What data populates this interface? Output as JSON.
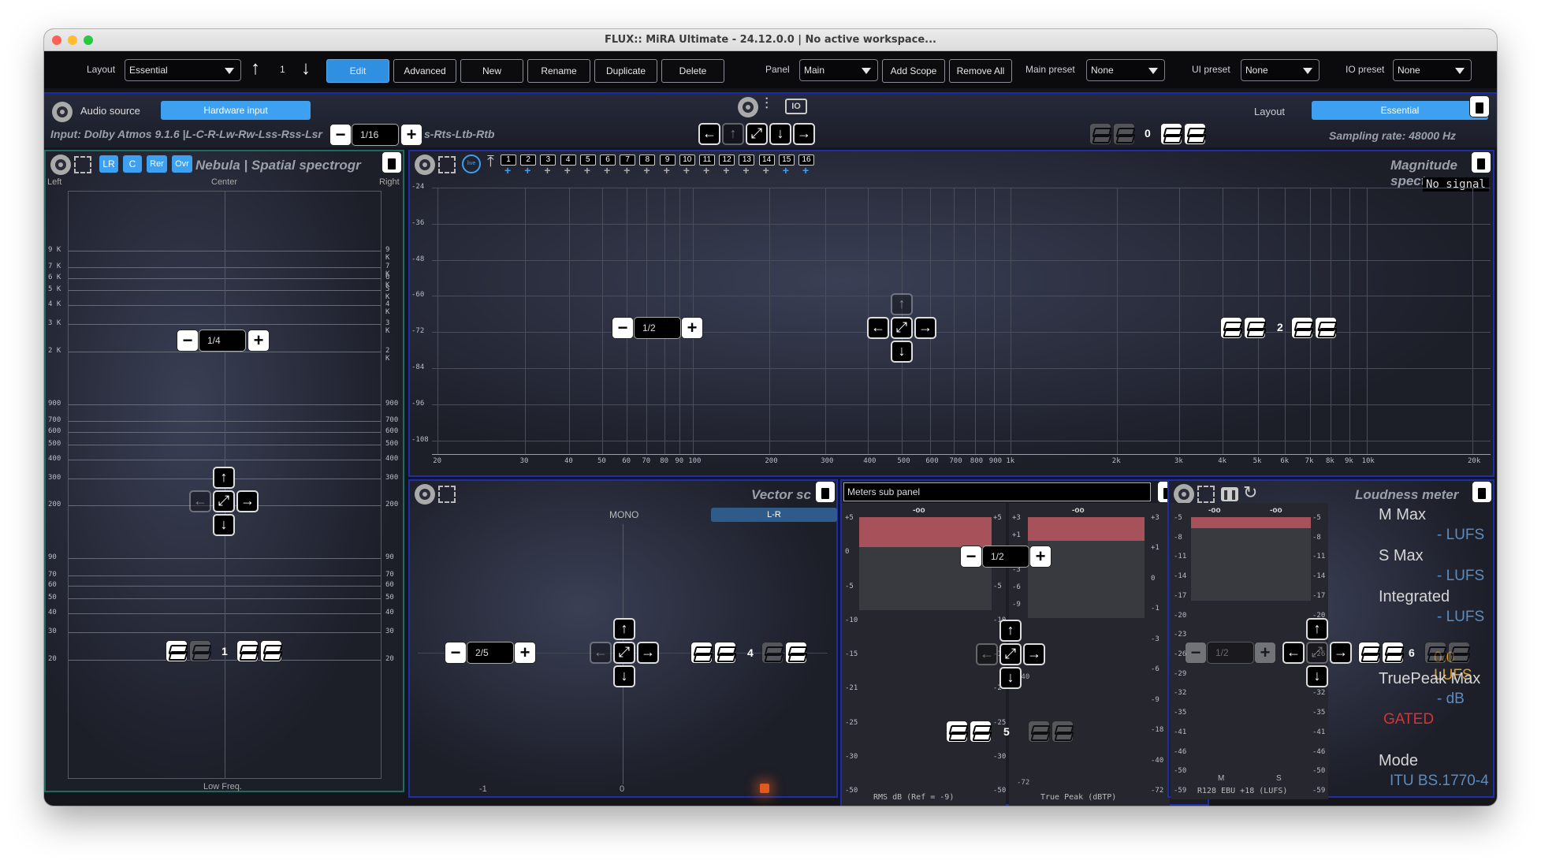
{
  "window": {
    "title": "FLUX:: MiRA Ultimate - 24.12.0.0 | No active workspace..."
  },
  "toolbar": {
    "layout_label": "Layout",
    "layout_value": "Essential",
    "layout_index": "1",
    "edit": "Edit",
    "advanced": "Advanced",
    "new": "New",
    "rename": "Rename",
    "duplicate": "Duplicate",
    "delete": "Delete",
    "panel_label": "Panel",
    "panel_value": "Main",
    "add_scope": "Add Scope",
    "remove_all": "Remove All",
    "main_preset_label": "Main preset",
    "main_preset_value": "None",
    "ui_preset_label": "UI preset",
    "ui_preset_value": "None",
    "io_preset_label": "IO preset",
    "io_preset_value": "None"
  },
  "source_bar": {
    "audio_source_label": "Audio source",
    "hardware_input": "Hardware input",
    "input_text": "Input: Dolby Atmos 9.1.6 |L-C-R-Lw-Rw-Lss-Rss-Lsr",
    "input_tail": "s-Rts-Ltb-Rtb",
    "division": "1/16",
    "layout_label": "Layout",
    "layout_value": "Essential",
    "layer_count": "0",
    "sampling_rate": "Sampling rate: 48000 Hz"
  },
  "nebula": {
    "buttons": [
      "LR",
      "C",
      "Rer",
      "Ovr"
    ],
    "title": "Nebula | Spatial spectrogr",
    "left": "Left",
    "center": "Center",
    "right": "Right",
    "bottom": "Low Freq.",
    "division": "1/4",
    "layer": "1",
    "ticks": [
      "9 K",
      "7 K",
      "6 K",
      "5 K",
      "4 K",
      "3 K",
      "2 K",
      "900",
      "700",
      "600",
      "500",
      "400",
      "300",
      "200",
      "90",
      "70",
      "60",
      "50",
      "40",
      "30",
      "20"
    ]
  },
  "magnitude": {
    "title": "Magnitude spectr",
    "no_signal": "No signal",
    "channels": [
      "1",
      "2",
      "3",
      "4",
      "5",
      "6",
      "7",
      "8",
      "9",
      "10",
      "11",
      "12",
      "13",
      "14",
      "15",
      "16"
    ],
    "y_ticks": [
      "-24",
      "-36",
      "-48",
      "-60",
      "-72",
      "-84",
      "-96",
      "-108"
    ],
    "x_ticks": [
      "20",
      "30",
      "40",
      "50",
      "60",
      "70",
      "80",
      "90",
      "100",
      "200",
      "300",
      "400",
      "500",
      "600",
      "700",
      "800",
      "900",
      "1k",
      "2k",
      "3k",
      "4k",
      "5k",
      "6k",
      "7k",
      "8k",
      "9k",
      "10k",
      "20k"
    ],
    "division": "1/2",
    "layer": "2"
  },
  "vector": {
    "title": "Vector sc",
    "mono": "MONO",
    "lr": "L-R",
    "division": "2/5",
    "layer": "4",
    "x_left": "-1",
    "x_mid": "0"
  },
  "meters": {
    "title": "Meters sub panel",
    "division": "1/2",
    "layer": "5",
    "rms_ticks": [
      "+5",
      "0",
      "-5",
      "-10",
      "-15",
      "-21",
      "-25",
      "-30",
      "-50"
    ],
    "rms_right_ticks": [
      "+5",
      "0",
      "-5",
      "-10",
      "-15",
      "-2",
      "-25",
      "-30",
      "-50"
    ],
    "tp_left_ticks": [
      "+3",
      "+1",
      "0",
      "-3",
      "-6",
      "-9"
    ],
    "tp_ticks": [
      "+3",
      "+1",
      "0",
      "-1",
      "-3",
      "-6",
      "-9",
      "-18",
      "-40",
      "-72"
    ],
    "peak": "-oo",
    "rms_caption": "RMS dB (Ref = -9)",
    "tp_caption": "True Peak (dBTP)",
    "lower_left": "-40",
    "lower_left2": "-72"
  },
  "loudness": {
    "title": "Loudness meter",
    "peak": "-oo",
    "division": "1/2",
    "layer": "6",
    "ticks": [
      "-5",
      "-8",
      "-11",
      "-14",
      "-17",
      "-20",
      "-23",
      "-26",
      "-29",
      "-32",
      "-35",
      "-41",
      "-46",
      "-50",
      "-59"
    ],
    "labels": {
      "m": "M",
      "s": "S"
    },
    "m_max": "M Max",
    "m_max_val": "- LUFS",
    "s_max": "S Max",
    "s_max_val": "- LUFS",
    "integrated": "Integrated",
    "integrated_val": "- LUFS",
    "short_val": "0.0 LUFS",
    "truepeak": "TruePeak Max",
    "truepeak_val": "- dB",
    "gated": "GATED",
    "mode": "Mode",
    "standard": "ITU BS.1770-4",
    "caption": "R128 EBU +18 (LUFS)"
  },
  "colors": {
    "accent": "#3da0f0",
    "panel_border": "#1d2ea8",
    "gated": "#e03030",
    "short_term": "#e0a020"
  }
}
